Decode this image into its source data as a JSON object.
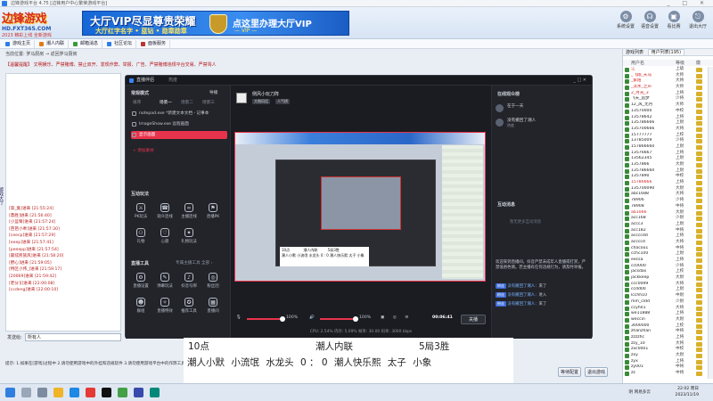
{
  "client": {
    "title": "边锋游戏平台 4.75 [边锋用户中心繁荣游戏平台]",
    "logo": {
      "line1": "边锋游戏",
      "line2": "HD.FXT365.COM",
      "line3": "2023 精彩上线 全新游戏"
    },
    "ad": {
      "title": "大厅VIP尽显尊贵荣耀",
      "sub": "大厅红字名字 • 蓝钻 • 勋章勋章",
      "right": "点这里办理大厅VIP",
      "right_sub": "— VIP —"
    },
    "tools": [
      {
        "label": "系统设置",
        "icon": "gear-icon",
        "glyph": "⚙"
      },
      {
        "label": "语音设置",
        "icon": "mic-icon",
        "glyph": "☊"
      },
      {
        "label": "看比赛",
        "icon": "tv-icon",
        "glyph": "▣"
      },
      {
        "label": "退出大厅",
        "icon": "exit-icon",
        "glyph": "⎋"
      }
    ],
    "nav_tabs": [
      {
        "label": "游戏主页",
        "color": "#2b7de9"
      },
      {
        "label": "潮人内联",
        "color": "#e07b1a"
      },
      {
        "label": "邮箱消息",
        "color": "#3a9a3a"
      },
      {
        "label": "社区论坛",
        "color": "#2b7de9"
      },
      {
        "label": "面板服务",
        "color": "#b33"
      }
    ],
    "breadcrumb": "当前位置: 罗马厨房 → 返回罗马厨房",
    "notice": "【温馨提醒】 文明娱乐、严禁赌博、禁止双开、发现作弊、举报、广告、严禁赌博违规平台交易、严禁骂人",
    "left_strip": "游戏大厅",
    "chat_lines": [
      "[第_集]进来 [21:55:24]",
      "[鼎胜]进来 [21:56:40]",
      "[小蓝莓]进来 [21:57:24]",
      "[芭芭小乖]进来 [21:57:30]",
      "[ceecp]进来 [21:57:29]",
      "[eeep]进来 [21:57:41]",
      "[peeepp]进来 [21:57:54]",
      "[最炫民族风]进来 [21:58:20]",
      "[野心]进来 [21:59:05]",
      "[特区小伟_]进来 [21:59:17]",
      "[20069]进来 [21:59:42]",
      "[老分][]进来 [22:00:08]",
      "[ccdeng]进来 [22:00:10]"
    ],
    "send_label": "发送给:",
    "send_value": "所有人",
    "tip": "提示: 1.如果在[游戏]过程中 2.请勿使用游戏中的外挂和违规软件 3.请勿使用游戏平台中的作弊工具进行游戏",
    "btn_wait": "等待配置",
    "btn_leave": "退出游戏",
    "rp_tabs": [
      "游戏列表",
      "用户列表(195)"
    ],
    "rp_head": [
      "用户名",
      "等级",
      "徽"
    ],
    "users": [
      {
        "name": "江",
        "lv": "上级",
        "vip": true
      },
      {
        "name": "_飞翔_天马",
        "lv": "大师",
        "vip": true
      },
      {
        "name": "_紫陌",
        "lv": "大将",
        "vip": true
      },
      {
        "name": "_流水_之声",
        "lv": "大师",
        "vip": true
      },
      {
        "name": "2_月光_3",
        "lv": "上将",
        "vip": true
      },
      {
        "name": "飞天_追梦",
        "lv": "少将",
        "vip": false
      },
      {
        "name": "12_风_无月",
        "lv": "大师",
        "vip": false
      },
      {
        "name": "13570000",
        "lv": "中校",
        "vip": false
      },
      {
        "name": "13578642",
        "lv": "上将",
        "vip": false
      },
      {
        "name": "135786666",
        "lv": "上尉",
        "vip": false
      },
      {
        "name": "135700666",
        "lv": "大将",
        "vip": false
      },
      {
        "name": "15777777",
        "lv": "上校",
        "vip": false
      },
      {
        "name": "13785009",
        "lv": "少将",
        "vip": false
      },
      {
        "name": "157866660",
        "lv": "上尉",
        "vip": false
      },
      {
        "name": "13576667",
        "lv": "上将",
        "vip": false
      },
      {
        "name": "13562345",
        "lv": "上尉",
        "vip": false
      },
      {
        "name": "1357866",
        "lv": "大尉",
        "vip": false
      },
      {
        "name": "135786660",
        "lv": "上尉",
        "vip": false
      },
      {
        "name": "1357890",
        "lv": "中校",
        "vip": false
      },
      {
        "name": "15786666",
        "lv": "上将",
        "vip": true
      },
      {
        "name": "135700090",
        "lv": "大尉",
        "vip": false
      },
      {
        "name": "abc1688",
        "lv": "大将",
        "vip": false
      },
      {
        "name": "78906",
        "lv": "少将",
        "vip": false
      },
      {
        "name": "78908",
        "lv": "中将",
        "vip": false
      },
      {
        "name": "ab1066",
        "lv": "大尉",
        "vip": true
      },
      {
        "name": "acc168",
        "lv": "少尉",
        "vip": false
      },
      {
        "name": "accc3",
        "lv": "上尉",
        "vip": false
      },
      {
        "name": "acc182",
        "lv": "中将",
        "vip": false
      },
      {
        "name": "accccdd",
        "lv": "上将",
        "vip": false
      },
      {
        "name": "accccd",
        "lv": "大将",
        "vip": false
      },
      {
        "name": "chacoo1",
        "lv": "中将",
        "vip": false
      },
      {
        "name": "cchc100",
        "lv": "上尉",
        "vip": false
      },
      {
        "name": "eecsa",
        "lv": "上将",
        "vip": false
      },
      {
        "name": "cc0000",
        "lv": "少将",
        "vip": false
      },
      {
        "name": "jacsdas",
        "lv": "上校",
        "vip": false
      },
      {
        "name": "jackkeep",
        "lv": "大尉",
        "vip": false
      },
      {
        "name": "ccc0099",
        "lv": "大将",
        "vip": false
      },
      {
        "name": "ccdd00",
        "lv": "上尉",
        "vip": false
      },
      {
        "name": "lcchh10",
        "lv": "中尉",
        "vip": false
      },
      {
        "name": "mm_cldd",
        "lv": "少尉",
        "vip": false
      },
      {
        "name": "ccyh01",
        "lv": "大将",
        "vip": false
      },
      {
        "name": "we11888",
        "lv": "上将",
        "vip": false
      },
      {
        "name": "weccin",
        "lv": "大尉",
        "vip": false
      },
      {
        "name": "3000000",
        "lv": "上校",
        "vip": false
      },
      {
        "name": "zhanzhan",
        "lv": "中将",
        "vip": false
      },
      {
        "name": "zzzzhc",
        "lv": "上将",
        "vip": false
      },
      {
        "name": "zzy_10",
        "lv": "大将",
        "vip": false
      },
      {
        "name": "zxc0001",
        "lv": "中校",
        "vip": false
      },
      {
        "name": "zxy",
        "lv": "大尉",
        "vip": false
      },
      {
        "name": "zyx",
        "lv": "上将",
        "vip": false
      },
      {
        "name": "zy001",
        "lv": "中将",
        "vip": false
      },
      {
        "name": "zz",
        "lv": "中将",
        "vip": false
      }
    ]
  },
  "stream": {
    "app_name": "直播伴侣",
    "app_sub": "热度",
    "channel_title": "侧风小玩刀阵",
    "channel_tags": [
      "大侧风话",
      "人气榜"
    ],
    "window_ctrl": "_ □ ✕",
    "scene_title": "常规模式",
    "scene_action": "导播",
    "sub_tabs": [
      "场景一",
      "场景二",
      "场景三"
    ],
    "sources": [
      {
        "label": "notepad.exe *新建文本文档 - 记事本",
        "sel": false
      },
      {
        "label": "ImageShow.exe 远程画面",
        "sel": false
      },
      {
        "label": "显示画面",
        "sel": true
      }
    ],
    "add_source": "+ 添加素材",
    "layer_label": "排序",
    "interact_title": "互动玩法",
    "interact_items": [
      {
        "label": "PK玩法",
        "glyph": "⚔"
      },
      {
        "label": "观众连线",
        "glyph": "☎"
      },
      {
        "label": "主播连线",
        "glyph": "∞"
      },
      {
        "label": "直播PK",
        "glyph": "⚑"
      },
      {
        "label": "礼物",
        "glyph": "⚇"
      },
      {
        "label": "心愿",
        "glyph": "♡"
      },
      {
        "label": "礼物玩法",
        "glyph": "✦"
      }
    ],
    "tools_title": "直播工具",
    "tools_hint": "专属主播工具 全部 ›",
    "tools": [
      {
        "label": "直播设置",
        "glyph": "⚙"
      },
      {
        "label": "弹幕玩法",
        "glyph": "✎"
      },
      {
        "label": "抖音号绑",
        "glyph": "♪"
      },
      {
        "label": "粉丝团",
        "glyph": "◎"
      },
      {
        "label": "群组",
        "glyph": "☻"
      },
      {
        "label": "直播特效",
        "glyph": "✧"
      },
      {
        "label": "推荐工具",
        "glyph": "✪"
      },
      {
        "label": "直播间",
        "glyph": "▦"
      }
    ],
    "preview": {
      "score_time": "10点",
      "score_room": "潮人内联",
      "score_rec": "5局3胜",
      "score_line": "潮人小默 小流氓 水龙头 0 : 0 潮人快乐熙 太子 小象"
    },
    "controls": {
      "vol1": "100%",
      "vol2": "100%",
      "timer": "00:06:41",
      "stop": "关播"
    },
    "status": "CPU: 2.54%  内存: 5.09%  帧率: 30.00  码率: 3000 kbps",
    "aud_title": "在线观众榜",
    "audience": [
      {
        "name": "在于一天",
        "sub": ""
      },
      {
        "name": "没有撤回了潮人",
        "sub": "热度"
      }
    ],
    "msg_title": "互动消息",
    "msg_empty": "暂无更多互动消息",
    "msgs": [
      {
        "tag": "",
        "who": "",
        "text": "欢迎来到直播间，抖音严禁未成年人直播或打赏，严禁低俗色情。若主播有任何违规行为，请及时举报。"
      },
      {
        "tag": "粉丝",
        "who": "没有撤回了潮人：",
        "text": "来了"
      },
      {
        "tag": "粉丝",
        "who": "没有撤回了潮人：",
        "text": "进入"
      },
      {
        "tag": "粉丝",
        "who": "没有撤回了潮人：",
        "text": "来了"
      }
    ]
  },
  "scoreboard": {
    "time": "10点",
    "room": "潮人内联",
    "record": "5局3胜",
    "team_a": [
      "潮人小默",
      "小流氓",
      "水龙头"
    ],
    "score": "0 ： 0",
    "team_b": [
      "潮人快乐熙",
      "太子",
      "小象"
    ]
  },
  "taskbar": {
    "weather": "阴",
    "tray": "网易多云",
    "time": "22:02 周日",
    "date": "2023/11/19"
  }
}
